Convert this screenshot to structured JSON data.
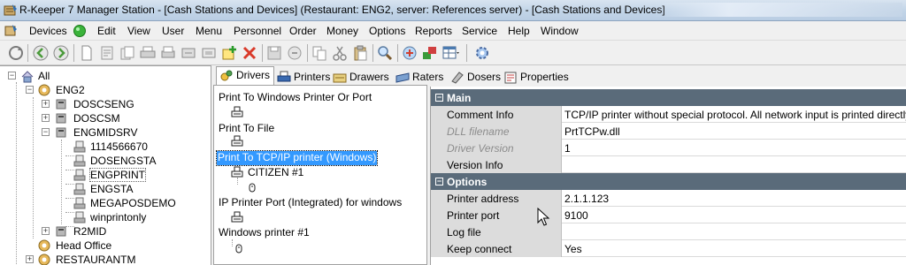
{
  "window": {
    "title": "R-Keeper 7 Manager Station - [Cash Stations and Devices] (Restaurant: ENG2, server: References server) - [Cash Stations and Devices]"
  },
  "menu": {
    "items": [
      "Devices",
      "Edit",
      "View",
      "User",
      "Menu",
      "Personnel",
      "Order",
      "Money",
      "Options",
      "Reports",
      "Service",
      "Help",
      "Window"
    ]
  },
  "tree": {
    "root": "All",
    "eng2": "ENG2",
    "doscseng": "DOSCSENG",
    "doscsm": "DOSCSM",
    "engmidsrv": "ENGMIDSRV",
    "n1114566670": "1114566670",
    "dosengsta": "DOSENGSTA",
    "engprint": "ENGPRINT",
    "engsta": "ENGSTA",
    "megaposdemo": "MEGAPOSDEMO",
    "winprintonly": "winprintonly",
    "r2mid": "R2MID",
    "head_office": "Head Office",
    "restaurantm": "RESTAURANTM"
  },
  "tabs": [
    "Drivers",
    "Printers",
    "Drawers",
    "Raters",
    "Dosers",
    "Properties"
  ],
  "drivers": {
    "windows_port": "Print To Windows Printer Or Port",
    "print_file": "Print To File",
    "tcpip": "Print To TCP/IP printer (Windows)",
    "citizen": "CITIZEN #1",
    "ip_port": "IP Printer Port (Integrated) for windows",
    "windows_printer": "Windows printer #1"
  },
  "props": {
    "main_section": "Main",
    "comment_key": "Comment Info",
    "comment_val": "TCP/IP printer without special protocol. All network input is printed directly.",
    "dll_key": "DLL filename",
    "dll_val": "PrtTCPw.dll",
    "driver_ver_key": "Driver Version",
    "driver_ver_val": "1",
    "version_info_key": "Version Info",
    "options_section": "Options",
    "addr_key": "Printer address",
    "addr_val": "2.1.1.123",
    "port_key": "Printer port",
    "port_val": "9100",
    "logfile_key": "Log file",
    "keep_key": "Keep connect",
    "keep_val": "Yes"
  },
  "colors": {
    "selection": "#3399ff",
    "section_header": "#5a6b7a",
    "key_cell": "#dcdcdc"
  }
}
